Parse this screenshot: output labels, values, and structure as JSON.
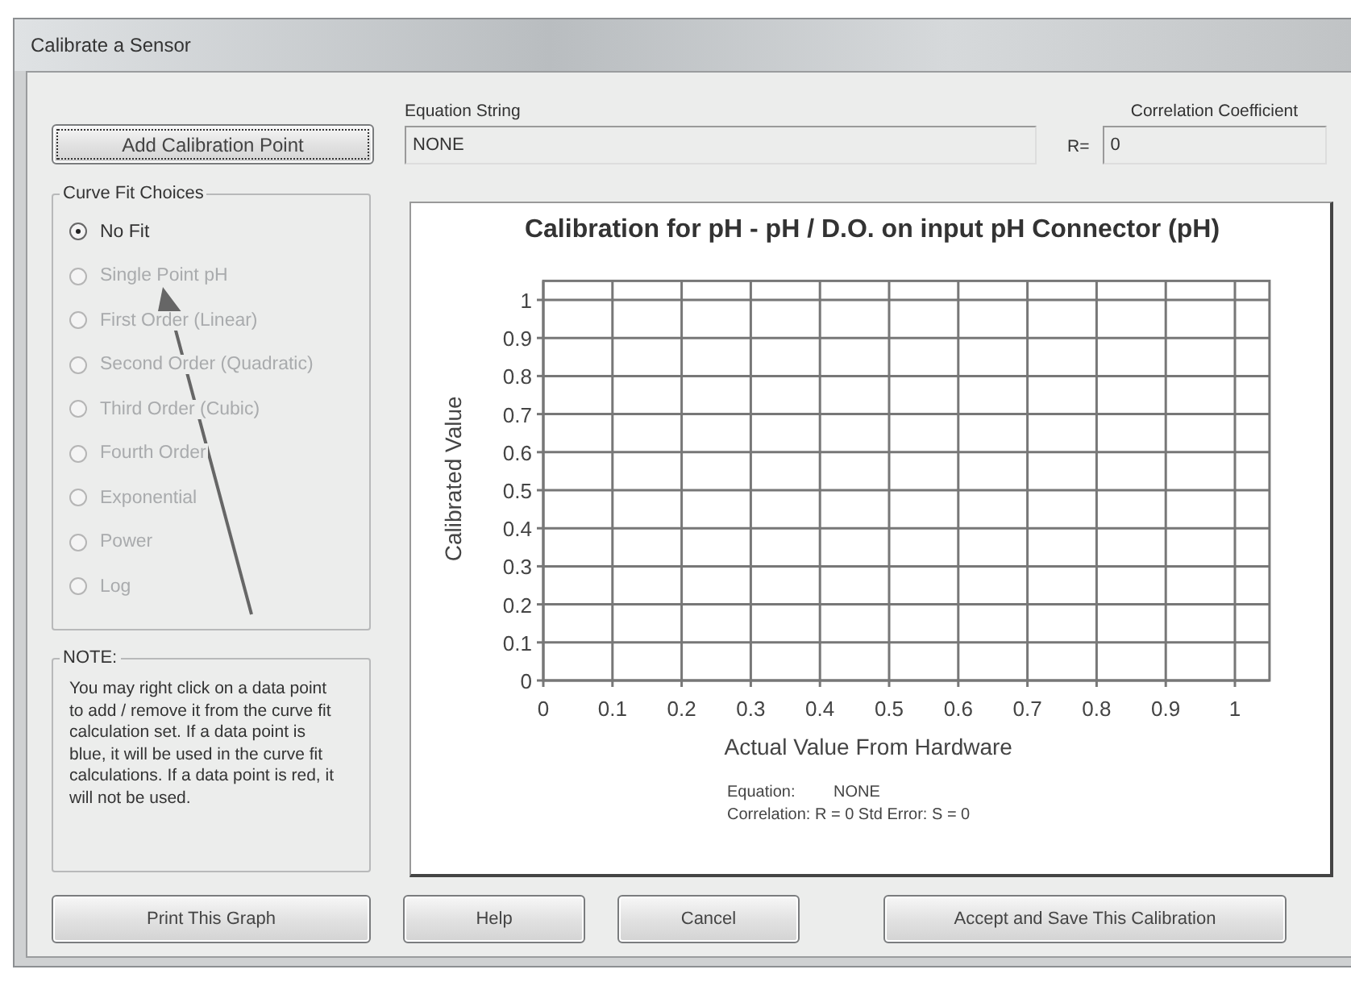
{
  "window": {
    "title": "Calibrate a Sensor"
  },
  "add_button": {
    "label": "Add Calibration Point"
  },
  "equation_string": {
    "label": "Equation String",
    "value": "NONE"
  },
  "correlation": {
    "label": "Correlation Coefficient",
    "prefix": "R=",
    "value": "0"
  },
  "curve_fit": {
    "title": "Curve Fit Choices",
    "choices": [
      {
        "label": "No Fit",
        "selected": true,
        "disabled": false
      },
      {
        "label": "Single Point pH",
        "selected": false,
        "disabled": true
      },
      {
        "label": "First Order (Linear)",
        "selected": false,
        "disabled": true
      },
      {
        "label": "Second Order (Quadratic)",
        "selected": false,
        "disabled": true
      },
      {
        "label": "Third Order (Cubic)",
        "selected": false,
        "disabled": true
      },
      {
        "label": "Fourth Order",
        "selected": false,
        "disabled": true
      },
      {
        "label": "Exponential",
        "selected": false,
        "disabled": true
      },
      {
        "label": "Power",
        "selected": false,
        "disabled": true
      },
      {
        "label": "Log",
        "selected": false,
        "disabled": true
      }
    ]
  },
  "note": {
    "title": "NOTE:",
    "text": "You may right click on a data point to add / remove it from the curve fit calculation set.  If a data point is blue, it will be used in the curve fit calculations.  If a data point is red, it will not be used."
  },
  "chart": {
    "chart_data": {
      "type": "scatter",
      "title": "Calibration for pH - pH / D.O. on input pH Connector (pH)",
      "xlabel": "Actual Value From Hardware",
      "ylabel": "Calibrated Value",
      "xlim": [
        0,
        1.05
      ],
      "ylim": [
        0,
        1.05
      ],
      "grid": true,
      "xticks": [
        0,
        0.1,
        0.2,
        0.3,
        0.4,
        0.5,
        0.6,
        0.7,
        0.8,
        0.9,
        1
      ],
      "yticks": [
        0,
        0.1,
        0.2,
        0.3,
        0.4,
        0.5,
        0.6,
        0.7,
        0.8,
        0.9,
        1
      ]
    },
    "equation_label": "Equation:",
    "equation_value": "NONE",
    "stats": "Correlation: R = 0  Std Error: S = 0"
  },
  "buttons": [
    {
      "label": "Print This Graph",
      "kind": "left"
    },
    {
      "label": "Help",
      "kind": "small"
    },
    {
      "label": "Cancel",
      "kind": "small"
    },
    {
      "label": "Accept and Save This Calibration",
      "kind": "wide"
    }
  ]
}
